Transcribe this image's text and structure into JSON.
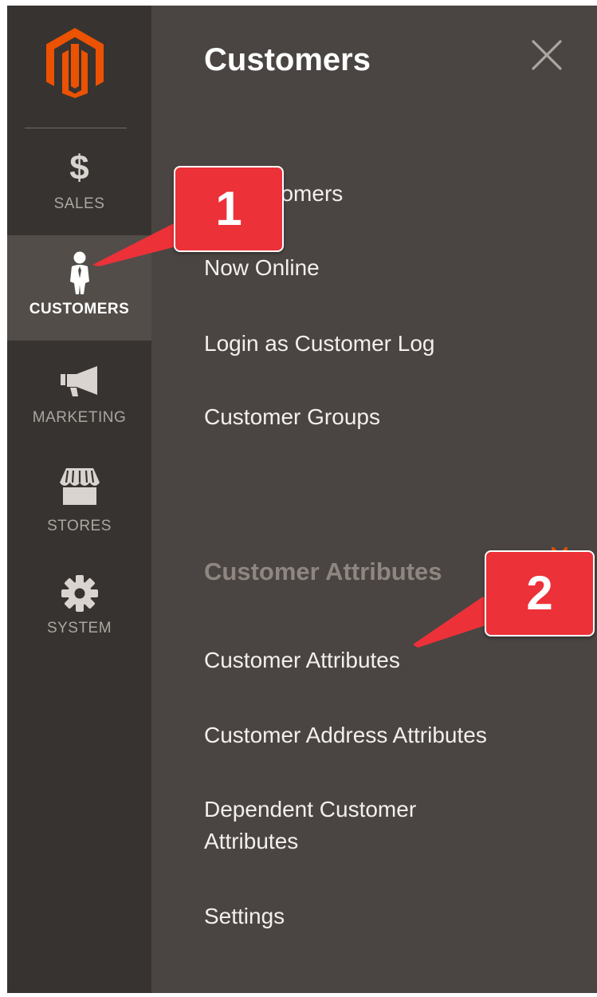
{
  "brand": {
    "logo": "magento-logo-icon",
    "color": "#eb5202"
  },
  "sidebar": {
    "items": [
      {
        "label": "SALES",
        "icon": "dollar-icon",
        "glyph": "$"
      },
      {
        "label": "CUSTOMERS",
        "icon": "customer-person-icon",
        "active": true
      },
      {
        "label": "MARKETING",
        "icon": "megaphone-icon"
      },
      {
        "label": "STORES",
        "icon": "store-awning-icon"
      },
      {
        "label": "SYSTEM",
        "icon": "gear-icon"
      }
    ]
  },
  "panel": {
    "title": "Customers",
    "close_icon": "close-icon",
    "links_primary": [
      "All Customers",
      "Now Online",
      "Login as Customer Log",
      "Customer Groups"
    ],
    "section_title": "Customer Attributes",
    "links_section": [
      "Customer Attributes",
      "Customer Address Attributes",
      "Dependent Customer Attributes",
      "Settings"
    ]
  },
  "annotations": {
    "callouts": [
      "1",
      "2"
    ],
    "color": "#ec3139"
  }
}
